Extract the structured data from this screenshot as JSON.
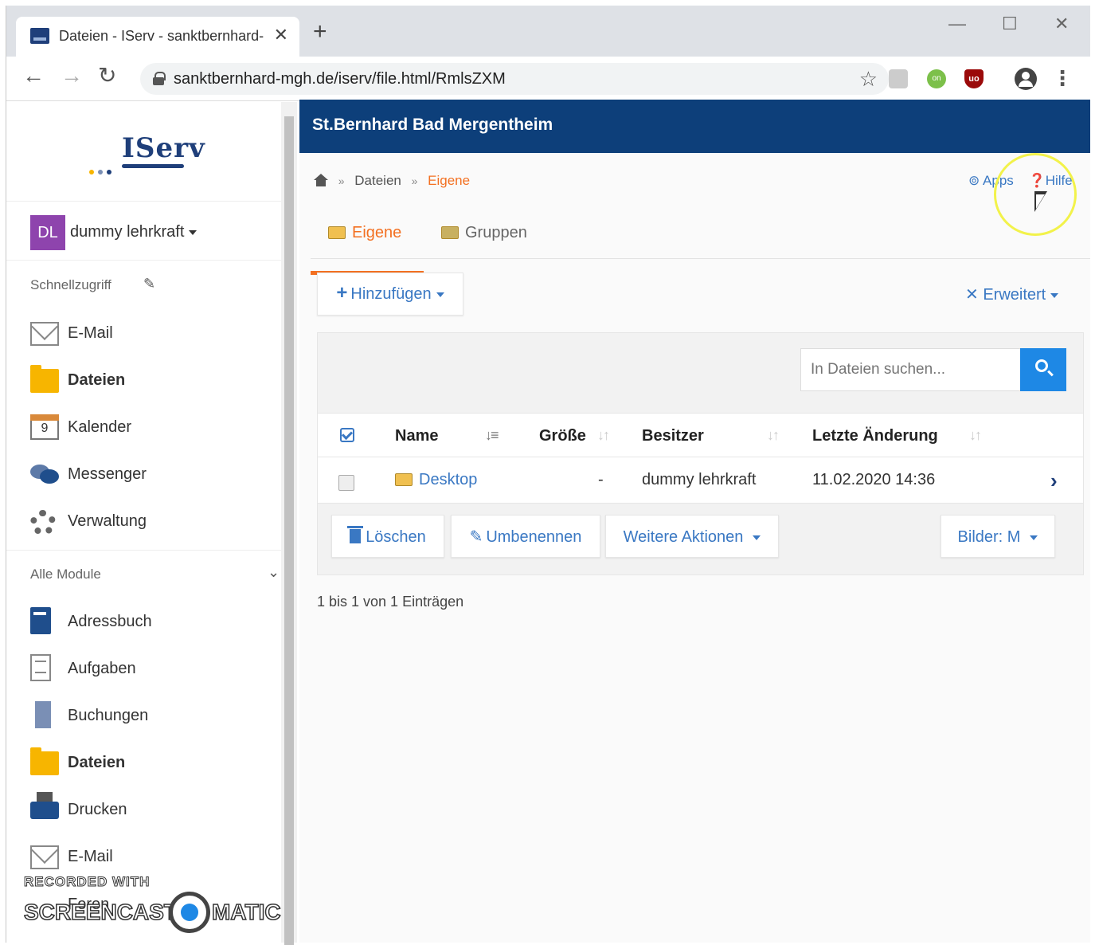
{
  "browser": {
    "tab_title": "Dateien - IServ - sanktbernhard-",
    "tab_close": "✕",
    "new_tab": "+",
    "url": "sanktbernhard-mgh.de/iserv/file.html/RmlsZXM",
    "win_min": "—",
    "win_max": "☐",
    "win_close": "✕",
    "back": "←",
    "forward": "→",
    "reload": "↻",
    "bookmark": "☆",
    "menu": "⋮",
    "ext_ublock": "uo",
    "ext_badge": "on"
  },
  "sidebar": {
    "logo": "IServ",
    "logo_dot_colors": [
      "#f7b500",
      "#7a8fb5",
      "#1f3f7a"
    ],
    "avatar_initials": "DL",
    "avatar_color": "#8e44ad",
    "user_name": "dummy lehrkraft",
    "quick_access_label": "Schnellzugriff",
    "quick_items": [
      {
        "label": "E-Mail",
        "icon": "mail-icon"
      },
      {
        "label": "Dateien",
        "icon": "folder-icon"
      },
      {
        "label": "Kalender",
        "icon": "calendar-icon",
        "icon_text": "9"
      },
      {
        "label": "Messenger",
        "icon": "messenger-icon"
      },
      {
        "label": "Verwaltung",
        "icon": "gear-icon"
      }
    ],
    "all_modules_label": "Alle Module",
    "modules": [
      {
        "label": "Adressbuch",
        "icon": "address-book-icon"
      },
      {
        "label": "Aufgaben",
        "icon": "tasks-icon"
      },
      {
        "label": "Buchungen",
        "icon": "bookings-icon"
      },
      {
        "label": "Dateien",
        "icon": "folder-icon"
      },
      {
        "label": "Drucken",
        "icon": "printer-icon"
      },
      {
        "label": "E-Mail",
        "icon": "mail-icon"
      },
      {
        "label": "Foren",
        "icon": "forum-icon"
      }
    ],
    "watermark_top": "RECORDED WITH",
    "watermark_left": "SCREENCAST",
    "watermark_right": "MATIC"
  },
  "main": {
    "site_title": "St.Bernhard Bad Mergentheim",
    "breadcrumb": {
      "sep": "»",
      "item1": "Dateien",
      "item2": "Eigene"
    },
    "top_links": {
      "apps": "Apps",
      "help": "Hilfe"
    },
    "tabs": {
      "own": "Eigene",
      "groups": "Gruppen"
    },
    "add_button": "Hinzufügen",
    "advanced_button": "Erweitert",
    "search_placeholder": "In Dateien suchen...",
    "table": {
      "columns": {
        "name": "Name",
        "size": "Größe",
        "owner": "Besitzer",
        "modified": "Letzte Änderung"
      },
      "rows": [
        {
          "name": "Desktop",
          "size": "-",
          "owner": "dummy lehrkraft",
          "modified": "11.02.2020 14:36"
        }
      ]
    },
    "actions": {
      "delete": "Löschen",
      "rename": "Umbenennen",
      "more": "Weitere Aktionen",
      "images": "Bilder: M"
    },
    "entries_info": "1 bis 1 von 1 Einträgen",
    "colors": {
      "header": "#0d3f7a",
      "accent": "#f37021",
      "link": "#3a78c3",
      "primary": "#1e88e5"
    }
  }
}
